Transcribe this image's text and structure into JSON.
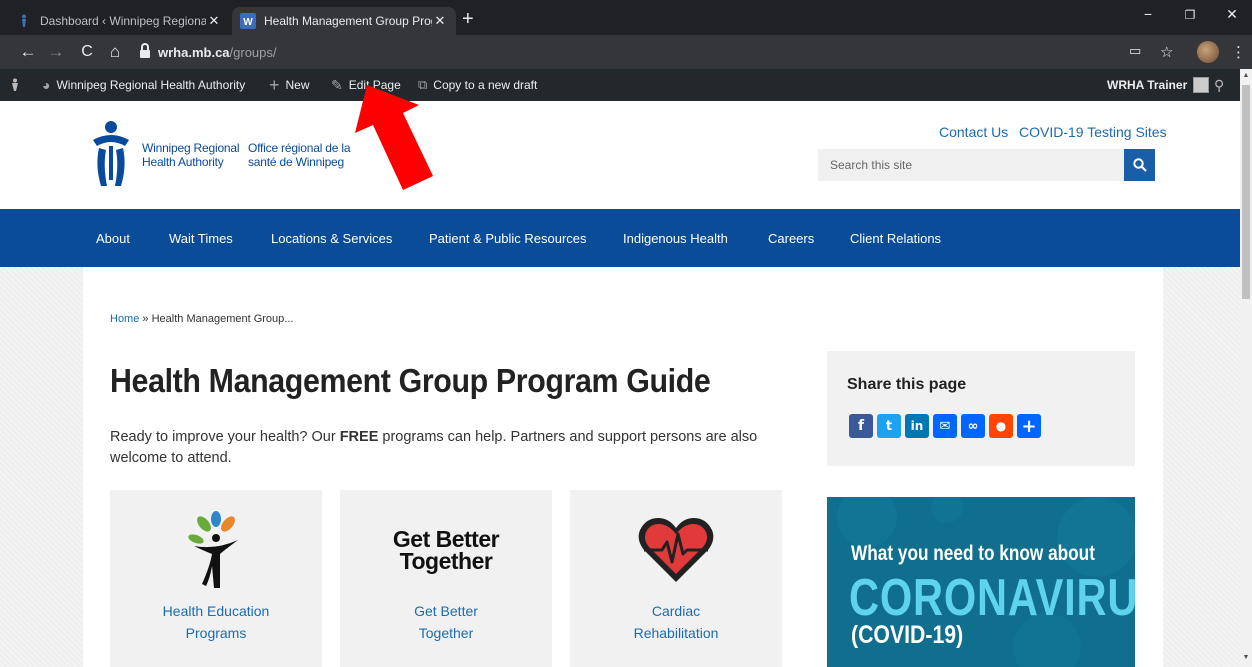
{
  "browser": {
    "tabs": [
      {
        "title": "Dashboard ‹ Winnipeg Regional H",
        "active": false
      },
      {
        "title": "Health Management Group Prog",
        "active": true
      }
    ],
    "url_host": "wrha.mb.ca",
    "url_path": "/groups/"
  },
  "adminbar": {
    "site_name": "Winnipeg Regional Health Authority",
    "new_label": "New",
    "edit_label": "Edit Page",
    "copy_label": "Copy to a new draft",
    "user_label": "WRHA Trainer"
  },
  "header": {
    "logo_en_line1": "Winnipeg Regional",
    "logo_en_line2": "Health Authority",
    "logo_fr_line1": "Office régional de la",
    "logo_fr_line2": "santé de Winnipeg",
    "links": [
      "Contact Us",
      "COVID-19 Testing Sites"
    ],
    "search_placeholder": "Search this site"
  },
  "nav": {
    "items": [
      "About",
      "Wait Times",
      "Locations & Services",
      "Patient & Public Resources",
      "Indigenous Health",
      "Careers",
      "Client Relations"
    ]
  },
  "main": {
    "breadcrumb_home": "Home",
    "breadcrumb_sep": "»",
    "breadcrumb_current": "Health Management Group...",
    "title": "Health Management Group Program Guide",
    "intro_before": "Ready to improve your health? Our ",
    "intro_bold": "FREE",
    "intro_after": " programs can help. Partners and support persons are also welcome to attend.",
    "cards": [
      {
        "line1": "Health Education",
        "line2": "Programs"
      },
      {
        "line1": "Get Better",
        "line2": "Together",
        "logo_line1": "Get Better",
        "logo_line2": "Together"
      },
      {
        "line1": "Cardiac",
        "line2": "Rehabilitation"
      }
    ]
  },
  "sidebar": {
    "share_title": "Share this page",
    "share_icons": [
      "facebook-icon",
      "twitter-icon",
      "linkedin-icon",
      "email-icon",
      "copy-link-icon",
      "reddit-icon",
      "more-share-icon"
    ],
    "covid_line1": "What you need to know about",
    "covid_line2": "CORONAVIRUS",
    "covid_line3": "(COVID-19)"
  },
  "colors": {
    "nav_blue": "#0b4c99",
    "link_blue": "#1c6bb0",
    "covid_teal": "#0f6f8c",
    "annotation_red": "#ff0000"
  }
}
